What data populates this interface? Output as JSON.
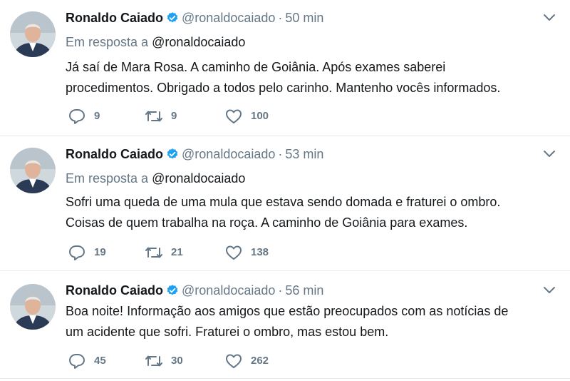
{
  "tweets": [
    {
      "name": "Ronaldo Caiado",
      "handle": "@ronaldocaiado",
      "separator": "·",
      "time": "50 min",
      "reply_prefix": "Em resposta a",
      "reply_mention": "@ronaldocaiado",
      "text_lines": [
        "Já saí de Mara Rosa. A caminho de Goiânia. Após exames saberei",
        "procedimentos. Obrigado a todos pelo carinho. Mantenho vocês informados."
      ],
      "replies": "9",
      "retweets": "9",
      "likes": "100"
    },
    {
      "name": "Ronaldo Caiado",
      "handle": "@ronaldocaiado",
      "separator": "·",
      "time": "53 min",
      "reply_prefix": "Em resposta a",
      "reply_mention": "@ronaldocaiado",
      "text_lines": [
        "Sofri uma queda de uma mula que estava sendo domada e fraturei o ombro.",
        "Coisas de quem trabalha na roça. A caminho de Goiânia para exames."
      ],
      "replies": "19",
      "retweets": "21",
      "likes": "138"
    },
    {
      "name": "Ronaldo Caiado",
      "handle": "@ronaldocaiado",
      "separator": "·",
      "time": "56 min",
      "text_lines": [
        "Boa noite! Informação aos amigos que estão preocupados com as notícias de",
        "um acidente que sofri. Fraturei o ombro, mas estou bem."
      ],
      "replies": "45",
      "retweets": "30",
      "likes": "262"
    }
  ],
  "colors": {
    "verified": "#1da1f2",
    "muted": "#657786",
    "text": "#14171a",
    "divider": "#e6ecf0"
  },
  "icons": [
    "verified-badge-icon",
    "chevron-down-icon",
    "reply-icon",
    "retweet-icon",
    "like-icon"
  ]
}
